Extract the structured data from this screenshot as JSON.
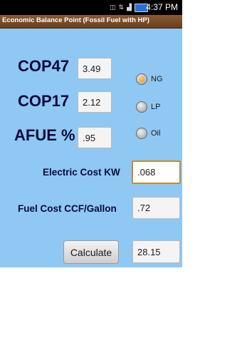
{
  "status_bar": {
    "time": "4:37 PM",
    "icons": [
      "vibrate-icon",
      "wifi-icon",
      "signal-icon",
      "battery-icon"
    ]
  },
  "app": {
    "title": "Economic Balance Point (Fossil Fuel with HP)"
  },
  "form": {
    "cop47": {
      "label": "COP47",
      "value": "3.49"
    },
    "cop17": {
      "label": "COP17",
      "value": "2.12"
    },
    "afue": {
      "label": "AFUE %",
      "value": ".95"
    },
    "electric_cost": {
      "label": "Electric Cost KW",
      "value": ".068"
    },
    "fuel_cost": {
      "label": "Fuel Cost CCF/Gallon",
      "value": ".72"
    },
    "calculate_label": "Calculate",
    "result": "28.15"
  },
  "fuel_type": {
    "options": [
      {
        "label": "NG",
        "selected": true
      },
      {
        "label": "LP",
        "selected": false
      },
      {
        "label": "Oil",
        "selected": false
      }
    ]
  },
  "colors": {
    "background": "#8fc8f2",
    "titlebar": "#7a4a25",
    "focus": "#c98a2c",
    "label": "#0a0a3a"
  }
}
